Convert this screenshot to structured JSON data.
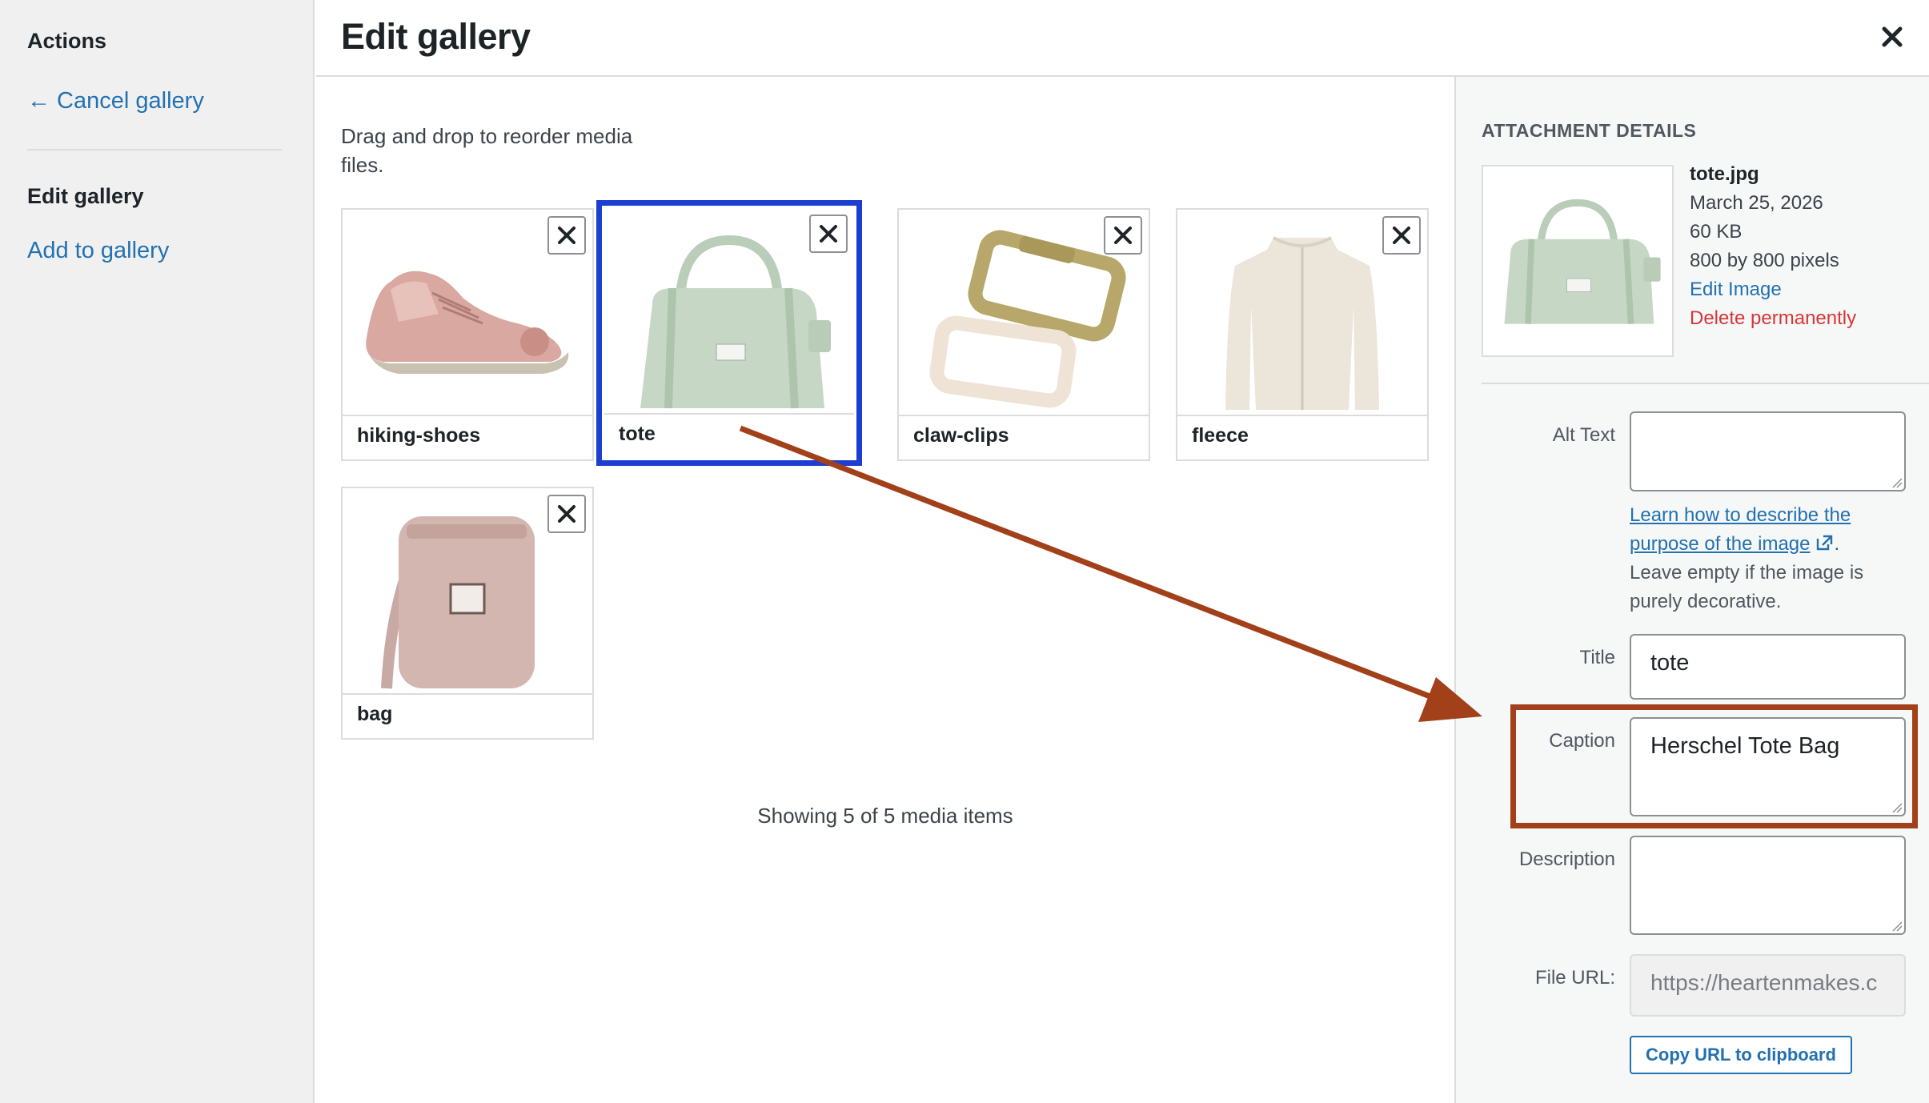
{
  "sidebar": {
    "heading": "Actions",
    "cancel_link": "← Cancel gallery",
    "current": "Edit gallery",
    "add_link": "Add to gallery"
  },
  "header": {
    "title": "Edit gallery",
    "close_icon": "close-icon"
  },
  "main": {
    "instructions": "Drag and drop to reorder media files.",
    "items": [
      {
        "label": "hiking-shoes",
        "icon": "shoe-image"
      },
      {
        "label": "tote",
        "icon": "tote-bag-image",
        "selected": true
      },
      {
        "label": "claw-clips",
        "icon": "hair-clip-image"
      },
      {
        "label": "fleece",
        "icon": "jacket-image"
      },
      {
        "label": "bag",
        "icon": "crossbody-bag-image"
      }
    ],
    "count_text": "Showing 5 of 5 media items"
  },
  "details": {
    "heading": "ATTACHMENT DETAILS",
    "filename": "tote.jpg",
    "date": "March 25, 2026",
    "size": "60 KB",
    "dimensions": "800 by 800 pixels",
    "edit_link": "Edit Image",
    "delete_link": "Delete permanently",
    "alt_label": "Alt Text",
    "alt_value": "",
    "help_link": "Learn how to describe the purpose of the image",
    "help_suffix": ".",
    "help_text": "Leave empty if the image is purely decorative.",
    "title_label": "Title",
    "title_value": "tote",
    "caption_label": "Caption",
    "caption_value": "Herschel Tote Bag",
    "description_label": "Description",
    "description_value": "",
    "url_label": "File URL:",
    "url_value": "https://heartenmakes.c",
    "copy_button": "Copy URL to clipboard"
  },
  "colors": {
    "link": "#2271b1",
    "delete": "#d63638",
    "selection": "#1c3fd1",
    "annotation": "#a2401a"
  }
}
